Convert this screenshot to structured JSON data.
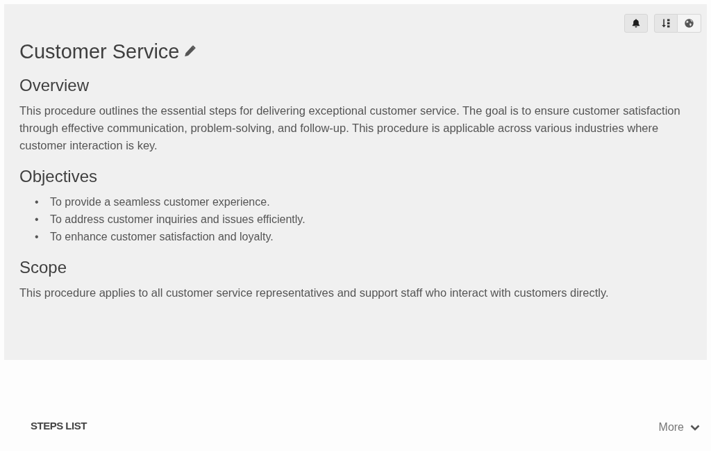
{
  "procedure": {
    "title": "Customer Service",
    "sections": [
      {
        "kind": "paragraph",
        "heading": "Overview",
        "text": "This procedure outlines the essential steps for delivering exceptional customer service. The goal is to ensure customer satisfaction through effective communication, problem-solving, and follow-up. This procedure is applicable across various industries where customer interaction is key."
      },
      {
        "kind": "bullets",
        "heading": "Objectives",
        "items": [
          {
            "marker": "•",
            "text": "To provide a seamless customer experience."
          },
          {
            "marker": "•",
            "text": "To address customer inquiries and issues efficiently."
          },
          {
            "marker": "•",
            "text": "To enhance customer satisfaction and loyalty."
          }
        ]
      },
      {
        "kind": "paragraph",
        "heading": "Scope",
        "text": "This procedure applies to all customer service representatives and support staff who interact with customers directly."
      }
    ]
  },
  "steps_list": {
    "title": "STEPS LIST",
    "more_label": "More"
  }
}
